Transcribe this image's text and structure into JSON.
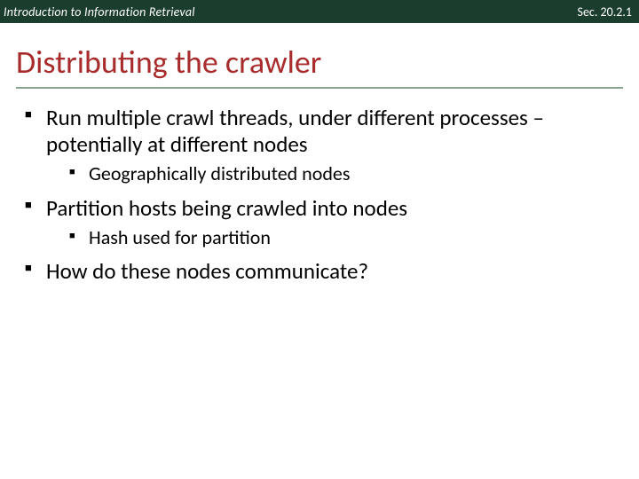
{
  "header": {
    "left": "Introduction to Information Retrieval",
    "right": "Sec. 20.2.1"
  },
  "title": "Distributing the crawler",
  "bullets": [
    {
      "text": "Run multiple crawl threads, under different processes – potentially at different nodes",
      "children": [
        {
          "text": "Geographically distributed nodes"
        }
      ]
    },
    {
      "text": "Partition hosts being crawled into nodes",
      "children": [
        {
          "text": "Hash used for partition"
        }
      ]
    },
    {
      "text": "How do these nodes communicate?",
      "children": []
    }
  ]
}
